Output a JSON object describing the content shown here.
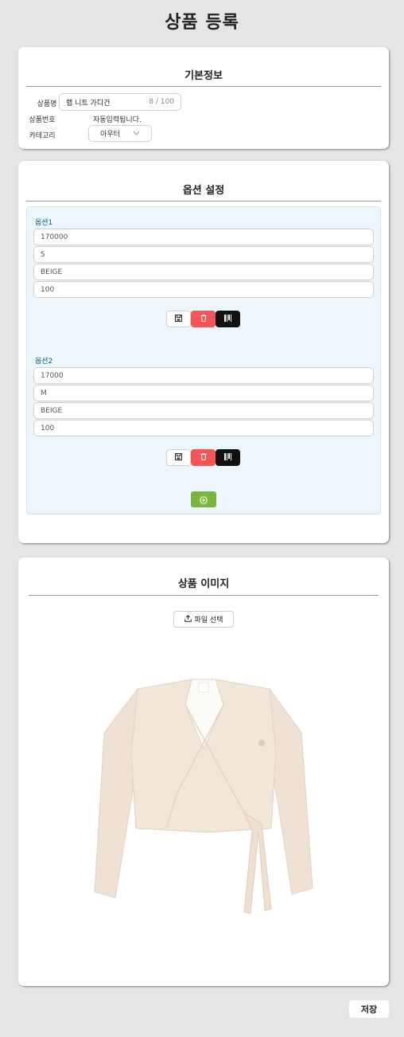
{
  "page": {
    "title": "상품 등록"
  },
  "basic_info": {
    "title": "기본정보",
    "name_label": "상품명",
    "name_value": "랩 니트 가디건",
    "name_count": "8 / 100",
    "number_label": "상품번호",
    "number_value": "자동입력됩니다.",
    "category_label": "카테고리",
    "category_value": "아우터"
  },
  "options": {
    "title": "옵션 설정",
    "items": [
      {
        "label": "옵션1",
        "price": "170000",
        "size": "S",
        "color": "BEIGE",
        "stock": "100"
      },
      {
        "label": "옵션2",
        "price": "17000",
        "size": "M",
        "color": "BEIGE",
        "stock": "100"
      }
    ]
  },
  "image_section": {
    "title": "상품 이미지",
    "file_button_label": "파일 선택",
    "image_subject": "beige wrap knit cardigan"
  },
  "footer": {
    "save_label": "저장"
  },
  "colors": {
    "delete": "#f25656",
    "add": "#7ab63e",
    "option_label": "#0b5d79",
    "panel_bg": "#eef6fd"
  },
  "icons": [
    "save-icon",
    "trash-icon",
    "barcode-icon",
    "plus-circle-icon",
    "upload-icon",
    "chevron-down-icon"
  ]
}
